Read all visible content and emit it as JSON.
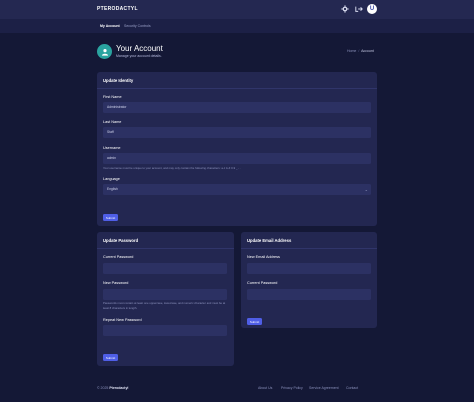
{
  "topbar": {
    "brand": "PTERODACTYL",
    "icons": [
      "cogs-icon",
      "sign-out-icon"
    ],
    "avatar_letter": "U"
  },
  "subnav": {
    "items": [
      {
        "label": "My Account",
        "active": true
      },
      {
        "label": "Security Controls",
        "active": false
      }
    ]
  },
  "header": {
    "title": "Your Account",
    "subtitle": "Manage your account details.",
    "breadcrumb": {
      "home": "Home",
      "separator": "/",
      "current": "Account"
    }
  },
  "identity": {
    "title": "Update Identity",
    "first_name_label": "First Name",
    "first_name_value": "Administrator",
    "last_name_label": "Last Name",
    "last_name_value": "Staff",
    "username_label": "Username",
    "username_value": "admin",
    "username_help": "Your username must be unique to your account, and may only contain the following characters: a-z A-Z 0-9 _ - .",
    "language_label": "Language",
    "language_value": "English",
    "submit": "Submit"
  },
  "password": {
    "title": "Update Password",
    "current_label": "Current Password",
    "new_label": "New Password",
    "help": "Passwords must contain at least one uppercase, lowercase, and numeric character and must be at least 8 characters in length.",
    "repeat_label": "Repeat New Password",
    "submit": "Submit"
  },
  "email": {
    "title": "Update Email Address",
    "new_label": "New Email Address",
    "current_label": "Current Password",
    "submit": "Submit"
  },
  "footer": {
    "copyright": "© 2025",
    "brand": "Pterodactyl",
    "links": [
      "About Us",
      "Privacy Policy",
      "Service Agreement",
      "Contact"
    ]
  },
  "colors": {
    "background": "#141836",
    "topbar": "#242851",
    "card": "#232751",
    "field": "#2c3163",
    "accent": "#4f5ee6",
    "avatar_teal": "#2aa3a0"
  }
}
